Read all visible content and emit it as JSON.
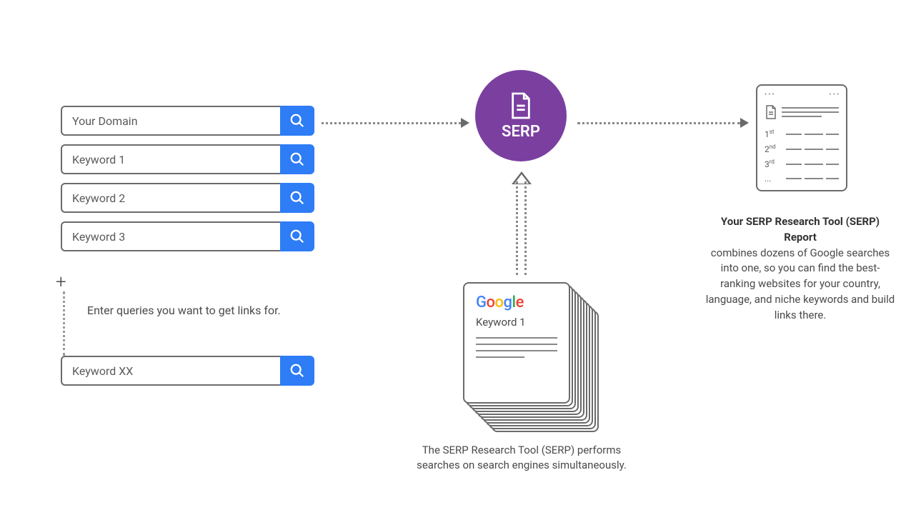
{
  "inputs": {
    "domain": "Your Domain",
    "kw1": "Keyword 1",
    "kw2": "Keyword 2",
    "kw3": "Keyword 3",
    "kwx": "Keyword XX",
    "hint": "Enter queries you want to get links for."
  },
  "serp": {
    "label": "SERP"
  },
  "google": {
    "logo_g1": "G",
    "logo_o1": "o",
    "logo_o2": "o",
    "logo_g2": "g",
    "logo_l": "l",
    "logo_e": "e",
    "keyword": "Keyword 1",
    "caption": "The SERP Research Tool (SERP) performs searches on search engines simultaneously."
  },
  "report": {
    "rank1": "1",
    "rank1_suffix": "st",
    "rank2": "2",
    "rank2_suffix": "nd",
    "rank3": "3",
    "rank3_suffix": "rd",
    "rank_more": "...",
    "title": "Your SERP Research Tool (SERP) Report",
    "body": "combines dozens of Google searches into one, so you can find the best-ranking websites for your country, language, and niche keywords and build links there."
  }
}
